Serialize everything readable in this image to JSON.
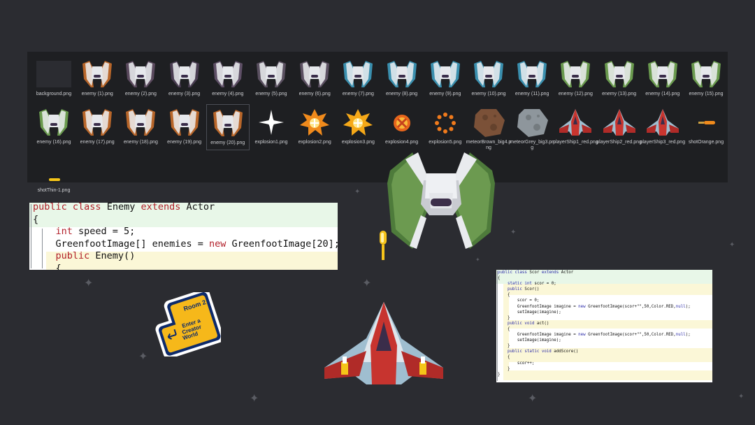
{
  "files": [
    {
      "name": "background.png",
      "thumb": "background",
      "color": "#2b2c31"
    },
    {
      "name": "enemy (1).png",
      "thumb": "enemy",
      "color": "#b8662a"
    },
    {
      "name": "enemy (2).png",
      "thumb": "enemy",
      "color": "#5b4a5e"
    },
    {
      "name": "enemy (3).png",
      "thumb": "enemy",
      "color": "#4a3d52"
    },
    {
      "name": "enemy (4).png",
      "thumb": "enemy",
      "color": "#5e4f66"
    },
    {
      "name": "enemy (5).png",
      "thumb": "enemy",
      "color": "#5a5060"
    },
    {
      "name": "enemy (6).png",
      "thumb": "enemy",
      "color": "#5c5062"
    },
    {
      "name": "enemy (7).png",
      "thumb": "enemy",
      "color": "#3a8fae"
    },
    {
      "name": "enemy (8).png",
      "thumb": "enemy",
      "color": "#3a8fae"
    },
    {
      "name": "enemy (9).png",
      "thumb": "enemy",
      "color": "#3a8fae"
    },
    {
      "name": "enemy (10).png",
      "thumb": "enemy",
      "color": "#3a8fae"
    },
    {
      "name": "enemy (11).png",
      "thumb": "enemy",
      "color": "#3a8fae"
    },
    {
      "name": "enemy (12).png",
      "thumb": "enemy",
      "color": "#6a9a4e"
    },
    {
      "name": "enemy (13).png",
      "thumb": "enemy",
      "color": "#6a9a4e"
    },
    {
      "name": "enemy (14).png",
      "thumb": "enemy",
      "color": "#6a9a4e"
    },
    {
      "name": "enemy (15).png",
      "thumb": "enemy",
      "color": "#6a9a4e"
    },
    {
      "name": "enemy (16).png",
      "thumb": "enemy",
      "color": "#6a9a4e"
    },
    {
      "name": "enemy (17).png",
      "thumb": "enemy",
      "color": "#b8662a"
    },
    {
      "name": "enemy (18).png",
      "thumb": "enemy",
      "color": "#b8662a"
    },
    {
      "name": "enemy (19).png",
      "thumb": "enemy",
      "color": "#b8662a"
    },
    {
      "name": "enemy (20).png",
      "thumb": "enemy",
      "color": "#b8662a",
      "selected": true
    },
    {
      "name": "explosion1.png",
      "thumb": "sparkle",
      "color": "#ffffff"
    },
    {
      "name": "explosion2.png",
      "thumb": "burst",
      "color": "#f08a1c"
    },
    {
      "name": "explosion3.png",
      "thumb": "burst",
      "color": "#f5a818"
    },
    {
      "name": "explosion4.png",
      "thumb": "xburst",
      "color": "#e8661c"
    },
    {
      "name": "explosion5.png",
      "thumb": "ring",
      "color": "#f07a1c"
    },
    {
      "name": "meteorBrown_big4.png",
      "thumb": "meteor",
      "color": "#7b5138"
    },
    {
      "name": "meteorGrey_big3.png",
      "thumb": "meteor",
      "color": "#8e969c"
    },
    {
      "name": "playerShip1_red.png",
      "thumb": "player",
      "color": "#c8352f"
    },
    {
      "name": "playerShip2_red.png",
      "thumb": "player",
      "color": "#c8352f"
    },
    {
      "name": "playerShip3_red.png",
      "thumb": "player",
      "color": "#c8352f"
    },
    {
      "name": "shotOrange.png",
      "thumb": "shot",
      "color": "#f08a1c"
    },
    {
      "name": "shotThin-1.png",
      "thumb": "shotthin",
      "color": "#f5c518"
    }
  ],
  "enemy_code": [
    [
      [
        "kw",
        "public "
      ],
      [
        "kw",
        "class "
      ],
      [
        "tx",
        "Enemy "
      ],
      [
        "kw",
        "extends "
      ],
      [
        "tx",
        "Actor"
      ]
    ],
    [
      [
        "tx",
        "{"
      ]
    ],
    [
      [
        "tx",
        "    "
      ],
      [
        "kw",
        "int "
      ],
      [
        "tx",
        "speed = 5;"
      ]
    ],
    [
      [
        "tx",
        "    GreenfootImage[] enemies = "
      ],
      [
        "kw",
        "new "
      ],
      [
        "tx",
        "GreenfootImage[20];"
      ]
    ],
    [
      [
        "tx",
        "    "
      ],
      [
        "kw",
        "public "
      ],
      [
        "tx",
        "Enemy()"
      ]
    ],
    [
      [
        "tx",
        "    {"
      ]
    ]
  ],
  "score_code": [
    [
      [
        "sk",
        "public "
      ],
      [
        "sk",
        "class "
      ],
      [
        "st",
        "Scor "
      ],
      [
        "sk",
        "extends "
      ],
      [
        "st",
        "Actor"
      ]
    ],
    [
      [
        "st",
        "{"
      ]
    ],
    [
      [
        "st",
        "    "
      ],
      [
        "sk",
        "static int "
      ],
      [
        "st",
        "scor = 0;"
      ]
    ],
    [
      [
        "st",
        "    "
      ],
      [
        "sk",
        "public "
      ],
      [
        "st",
        "Scor()"
      ]
    ],
    [
      [
        "st",
        "    {"
      ]
    ],
    [
      [
        "st",
        "        scor = 0;"
      ]
    ],
    [
      [
        "st",
        "        GreenfootImage imagine = "
      ],
      [
        "sk",
        "new "
      ],
      [
        "st",
        "GreenfootImage(scor+\"\",50,Color.RED,"
      ],
      [
        "sk",
        "null"
      ],
      [
        "st",
        ");"
      ]
    ],
    [
      [
        "st",
        "        setImage(imagine);"
      ]
    ],
    [
      [
        "st",
        "    }"
      ]
    ],
    [
      [
        "st",
        "    "
      ],
      [
        "sk",
        "public void "
      ],
      [
        "st",
        "act()"
      ]
    ],
    [
      [
        "st",
        "    {"
      ]
    ],
    [
      [
        "st",
        "        GreenfootImage imagine = "
      ],
      [
        "sk",
        "new "
      ],
      [
        "st",
        "GreenfootImage(scor+\"\",50,Color.RED,"
      ],
      [
        "sk",
        "null"
      ],
      [
        "st",
        ");"
      ]
    ],
    [
      [
        "st",
        "        setImage(imagine);"
      ]
    ],
    [
      [
        "st",
        "    }"
      ]
    ],
    [
      [
        "st",
        "    "
      ],
      [
        "sk",
        "public static void "
      ],
      [
        "st",
        "addScore()"
      ]
    ],
    [
      [
        "st",
        "    {"
      ]
    ],
    [
      [
        "st",
        "        scor++;"
      ]
    ],
    [
      [
        "st",
        "    }"
      ]
    ],
    [
      [
        "st",
        "}"
      ]
    ]
  ],
  "room_badge": {
    "room": "Room 2",
    "line1": "Enter a",
    "line2": "Creator",
    "line3": "World"
  },
  "colors": {
    "background": "#2b2c31",
    "browser_bg": "#1e1f22",
    "keyword_red": "#b2202a",
    "keyword_blue": "#2a2aa8",
    "badge_yellow": "#f6b81a",
    "badge_navy": "#0d2a6b"
  }
}
